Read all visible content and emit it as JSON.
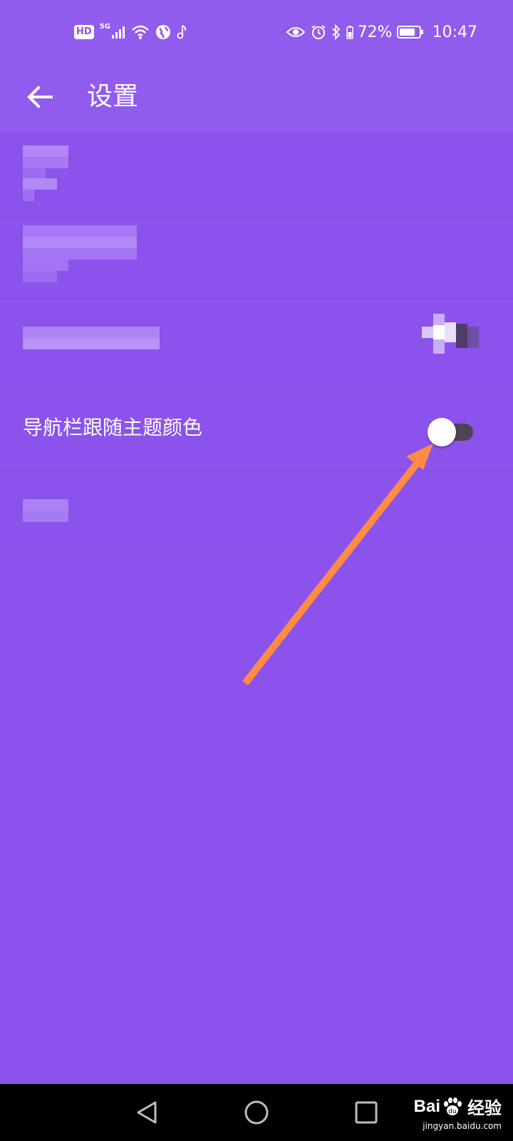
{
  "status_bar": {
    "hd": "HD",
    "network": "5G",
    "battery_percent": "72%",
    "time": "10:47"
  },
  "toolbar": {
    "title": "设置"
  },
  "settings": {
    "rows": [
      {
        "label": "",
        "redacted": true
      },
      {
        "label": "",
        "redacted": true
      },
      {
        "label": "",
        "redacted": true
      },
      {
        "label": "导航栏跟随主题颜色",
        "toggle_on": false
      },
      {
        "label": "",
        "redacted": true
      }
    ]
  },
  "annotation": {
    "arrow_color": "#ff8c42"
  },
  "watermark": {
    "brand": "Bai",
    "brand_suffix": "经验",
    "url": "jingyan.baidu.com"
  },
  "colors": {
    "background": "#8b52ec",
    "header": "#915bee",
    "nav_bar": "#000000"
  },
  "icons": [
    "back-arrow-icon",
    "signal-icon",
    "wifi-icon",
    "globe-icon",
    "music-note-icon",
    "eye-icon",
    "alarm-icon",
    "bluetooth-icon",
    "battery-icon",
    "nav-back-icon",
    "nav-home-icon",
    "nav-recents-icon",
    "paw-icon"
  ]
}
